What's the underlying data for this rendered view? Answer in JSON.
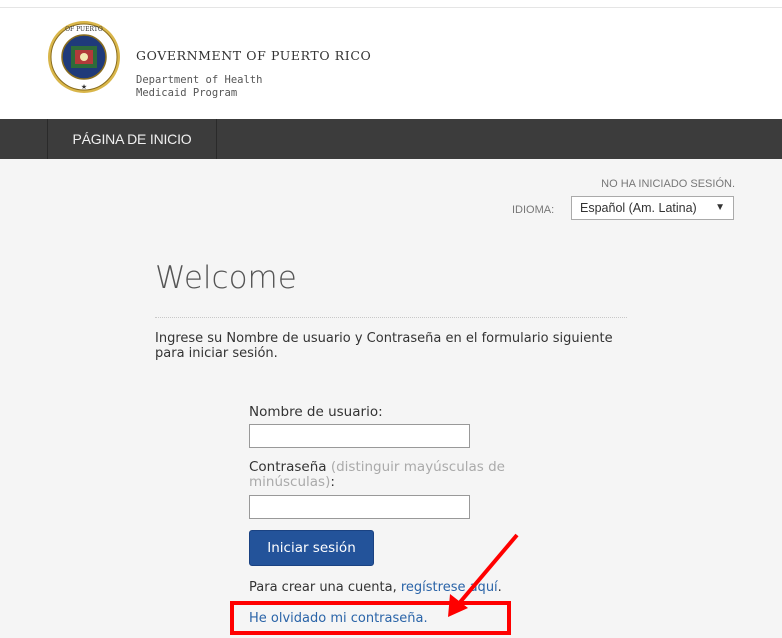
{
  "header": {
    "gov_title": "GOVERNMENT OF PUERTO RICO",
    "dept_line1": "Department of Health",
    "dept_line2": "Medicaid Program",
    "seal_text": "GOBIERNO DE PUERTO RICO"
  },
  "nav": {
    "home_label": "PÁGINA DE INICIO"
  },
  "status": {
    "login_status": "NO HA INICIADO SESIÓN.",
    "language_label": "IDIOMA:",
    "language_selected": "Español (Am. Latina)"
  },
  "login": {
    "title": "Welcome",
    "intro": "Ingrese su Nombre de usuario y Contraseña en el formulario siguiente para iniciar sesión.",
    "username_label": "Nombre de usuario:",
    "username_value": "",
    "password_label": "Contraseña",
    "password_hint": "(distinguir mayúsculas de minúsculas)",
    "password_colon": ":",
    "password_value": "",
    "submit_label": "Iniciar sesión",
    "create_text": "Para crear una cuenta, ",
    "register_link": "regístrese aquí",
    "create_period": ".",
    "forgot_link": "He olvidado mi contraseña."
  },
  "annotation": {
    "color": "#ff0000"
  },
  "colors": {
    "nav_bg": "#3c3c3c",
    "content_bg": "#f5f5f5",
    "button_bg": "#23539a",
    "link": "#2a64a8"
  }
}
